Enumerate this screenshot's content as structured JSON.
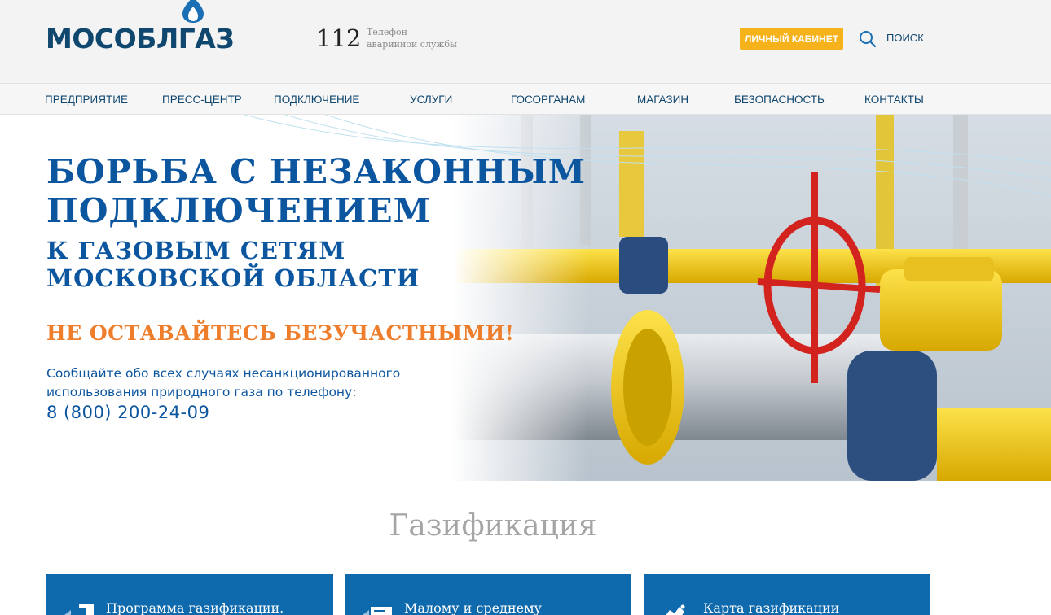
{
  "header": {
    "logo_text": "МОСОБЛГАЗ",
    "emergency_number": "112",
    "emergency_desc_line1": "Телефон",
    "emergency_desc_line2": "аварийной службы",
    "cabinet_label": "ЛИЧНЫЙ КАБИНЕТ",
    "search_label": "ПОИСК",
    "search_icon": "search-icon"
  },
  "nav": {
    "items": [
      {
        "label": "ПРЕДПРИЯТИЕ"
      },
      {
        "label": "ПРЕСС-ЦЕНТР"
      },
      {
        "label": "ПОДКЛЮЧЕНИЕ"
      },
      {
        "label": "УСЛУГИ"
      },
      {
        "label": "ГОСОРГАНАМ"
      },
      {
        "label": "МАГАЗИН"
      },
      {
        "label": "БЕЗОПАСНОСТЬ"
      },
      {
        "label": "КОНТАКТЫ"
      }
    ]
  },
  "hero": {
    "title_line1": "БОРЬБА С НЕЗАКОННЫМ",
    "title_line2": "ПОДКЛЮЧЕНИЕМ",
    "subtitle_line1": "К ГАЗОВЫМ СЕТЯМ",
    "subtitle_line2": "МОСКОВСКОЙ ОБЛАСТИ",
    "call": "НЕ ОСТАВАЙТЕСЬ БЕЗУЧАСТНЫМИ!",
    "text_line1": "Сообщайте обо всех случаях несанкционированного",
    "text_line2": "использования природного газа по телефону:",
    "phone": "8 (800) 200-24-09"
  },
  "section": {
    "title": "Газификация",
    "cards": [
      {
        "label": "Программа газификации.",
        "icon": "program-icon"
      },
      {
        "label": "Малому и среднему",
        "icon": "document-icon"
      },
      {
        "label": "Карта газификации",
        "icon": "map-icon"
      }
    ]
  },
  "colors": {
    "brand": "#10476e",
    "accent_yellow": "#f6b21b",
    "hero_blue": "#0c56a0",
    "hero_orange": "#ef7e2c",
    "card_blue": "#0f6aad"
  }
}
